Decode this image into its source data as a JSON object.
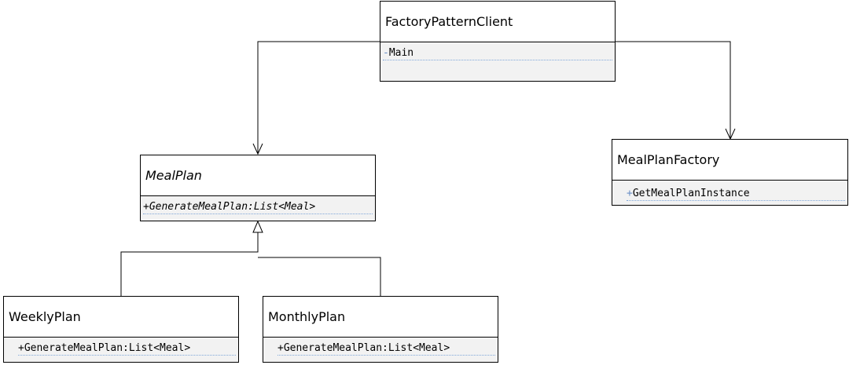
{
  "diagram": {
    "classes": [
      {
        "id": "client",
        "name": "FactoryPatternClient",
        "abstract": false,
        "members": [
          {
            "visibility": "-",
            "label": "Main",
            "abstract": false
          }
        ]
      },
      {
        "id": "mealplan",
        "name": "MealPlan",
        "abstract": true,
        "members": [
          {
            "visibility": "+",
            "label": "GenerateMealPlan:List<Meal>",
            "abstract": true
          }
        ]
      },
      {
        "id": "factory",
        "name": "MealPlanFactory",
        "abstract": false,
        "members": [
          {
            "visibility": "+",
            "label": "GetMealPlanInstance",
            "abstract": false
          }
        ]
      },
      {
        "id": "weekly",
        "name": "WeeklyPlan",
        "abstract": false,
        "members": [
          {
            "visibility": "+",
            "label": "GenerateMealPlan:List<Meal>",
            "abstract": false
          }
        ]
      },
      {
        "id": "monthly",
        "name": "MonthlyPlan",
        "abstract": false,
        "members": [
          {
            "visibility": "+",
            "label": "GenerateMealPlan:List<Meal>",
            "abstract": false
          }
        ]
      }
    ],
    "relations": [
      {
        "from": "client",
        "to": "mealplan",
        "kind": "association"
      },
      {
        "from": "client",
        "to": "factory",
        "kind": "association"
      },
      {
        "from": "weekly",
        "to": "mealplan",
        "kind": "generalization"
      },
      {
        "from": "monthly",
        "to": "mealplan",
        "kind": "generalization"
      }
    ],
    "colors": {
      "line": "#000000",
      "member_background": "#f2f2f2",
      "member_separator": "#7fa7d9",
      "visibility_marker": "#6a8fc7"
    }
  }
}
